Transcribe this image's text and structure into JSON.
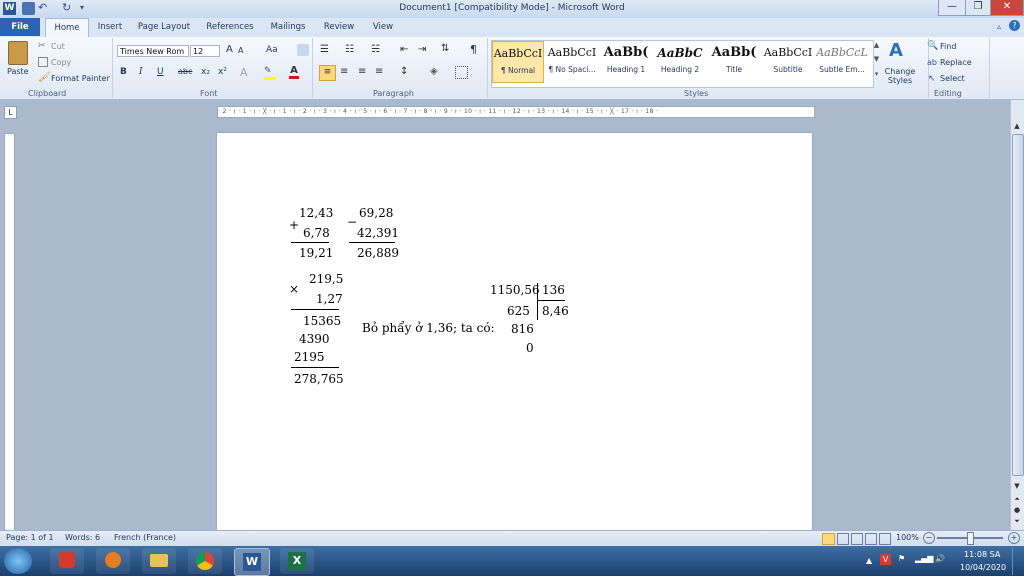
{
  "window": {
    "title": "Document1 [Compatibility Mode]  -  Microsoft Word",
    "minimize_glyph": "—",
    "restore_glyph": "❐",
    "close_glyph": "✕",
    "help_glyph": "?"
  },
  "tabs": [
    "File",
    "Home",
    "Insert",
    "Page Layout",
    "References",
    "Mailings",
    "Review",
    "View"
  ],
  "ribbon": {
    "clipboard": {
      "paste": "Paste",
      "cut": "Cut",
      "copy": "Copy",
      "format_painter": "Format Painter",
      "label": "Clipboard"
    },
    "font": {
      "name": "Times New Rom",
      "size": "12",
      "label": "Font",
      "bold": "B",
      "italic": "I",
      "underline": "U",
      "strike": "abc",
      "subscript": "x₂",
      "superscript": "x²",
      "grow": "A",
      "shrink": "A",
      "case": "Aa"
    },
    "paragraph": {
      "label": "Paragraph",
      "pilcrow": "¶"
    },
    "styles": {
      "label": "Styles",
      "items": [
        {
          "preview": "AaBbCcI",
          "name": "¶ Normal"
        },
        {
          "preview": "AaBbCcI",
          "name": "¶ No Spaci..."
        },
        {
          "preview": "AaBb(",
          "name": "Heading 1"
        },
        {
          "preview": "AaBbC",
          "name": "Heading 2"
        },
        {
          "preview": "AaBb(",
          "name": "Title"
        },
        {
          "preview": "AaBbCcI",
          "name": "Subtitle"
        },
        {
          "preview": "AaBbCcL",
          "name": "Subtle Em..."
        }
      ],
      "change_styles": "Change Styles"
    },
    "editing": {
      "label": "Editing",
      "find": "Find",
      "replace": "Replace",
      "select": "Select"
    }
  },
  "ruler": {
    "marks": "· 2 · ı · 1 · ı · ╳ · ı · 1 · ı · 2 · ı · 3 · ı · 4 · ı · 5 · ı · 6 · ı · 7 · ı · 8 · ı · 9 · ı · 10 · ı · 11 · ı · 12 · ı · 13 · ı · 14 · ı · 15 · ı · ╳ · 17 · ı · 18 ·"
  },
  "document": {
    "add": {
      "sign": "+",
      "a": "12,43",
      "b": "6,78",
      "result": "19,21"
    },
    "sub": {
      "sign": "−",
      "a": "69,28",
      "b": "42,391",
      "result": "26,889"
    },
    "mul": {
      "sign": "×",
      "a": "219,5",
      "b": "1,27",
      "p1": "15365",
      "p2": "4390",
      "p3": "2195",
      "result": "278,765"
    },
    "note": "Bỏ phẩy ở 1,36; ta có:",
    "div": {
      "dividend": "1150,56",
      "divisor": "136",
      "r1": "625",
      "quotient": "8,46",
      "r2": "816",
      "r3": "0"
    }
  },
  "status": {
    "page": "Page: 1 of 1",
    "words": "Words: 6",
    "language": "French (France)",
    "zoom": "100%"
  },
  "taskbar": {
    "time": "11:08 SA",
    "date": "10/04/2020"
  }
}
